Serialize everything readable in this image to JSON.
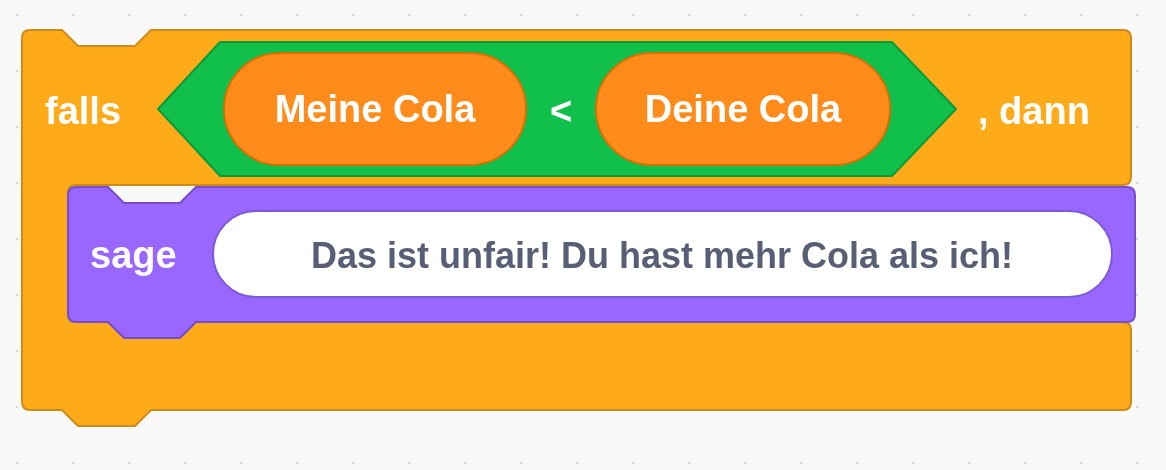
{
  "blocks": [
    {
      "kind": "if",
      "label": "falls",
      "suffix": ", dann",
      "condition": {
        "kind": "less_than",
        "left": "Meine Cola",
        "operator": "<",
        "right": "Deine Cola"
      },
      "body": [
        {
          "kind": "say",
          "label": "sage",
          "message": "Das ist unfair! Du hast mehr Cola als ich!"
        }
      ]
    }
  ]
}
